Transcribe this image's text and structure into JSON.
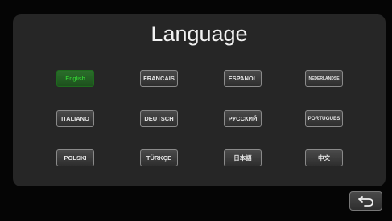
{
  "header": {
    "title": "Language"
  },
  "languages": [
    {
      "label": "English",
      "selected": true
    },
    {
      "label": "FRANCAIS",
      "selected": false
    },
    {
      "label": "ESPANOL",
      "selected": false
    },
    {
      "label": "NEDERLANDSE",
      "selected": false
    },
    {
      "label": "ITALIANO",
      "selected": false
    },
    {
      "label": "DEUTSCH",
      "selected": false
    },
    {
      "label": "РУССКИЙ",
      "selected": false
    },
    {
      "label": "PORTUGUES",
      "selected": false
    },
    {
      "label": "POLSKI",
      "selected": false
    },
    {
      "label": "TÜRKÇE",
      "selected": false
    },
    {
      "label": "日本語",
      "selected": false
    },
    {
      "label": "中文",
      "selected": false
    }
  ],
  "footer": {
    "back_icon": "back-arrow-icon"
  },
  "colors": {
    "selected_text": "#36e036",
    "selected_bg": "#1d511d",
    "panel_bg": "#262626"
  }
}
